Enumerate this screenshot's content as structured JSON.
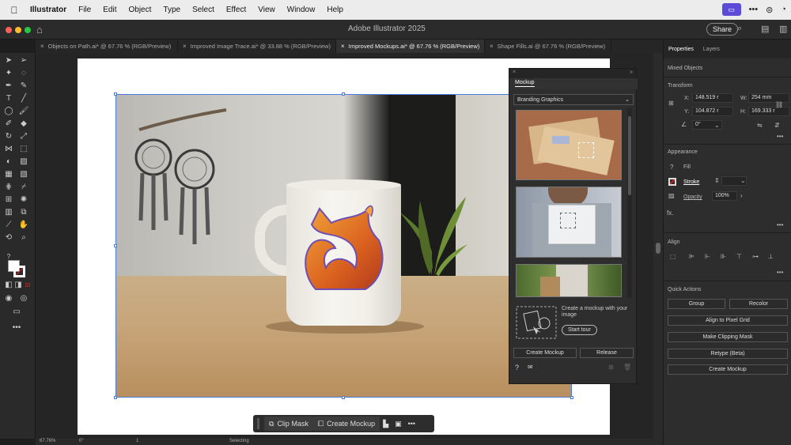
{
  "menubar": {
    "app_name": "Illustrator",
    "items": [
      "File",
      "Edit",
      "Object",
      "Type",
      "Select",
      "Effect",
      "View",
      "Window",
      "Help"
    ]
  },
  "titlebar": {
    "title": "Adobe Illustrator 2025",
    "share_label": "Share"
  },
  "tabs": [
    {
      "label": "Objects on Path.ai* @ 67.76 % (RGB/Preview)",
      "active": false
    },
    {
      "label": "Improved Image Trace.ai* @ 33.88 % (RGB/Preview)",
      "active": false
    },
    {
      "label": "Improved Mockups.ai* @ 67.76 % (RGB/Preview)",
      "active": true
    },
    {
      "label": "Shape Fills.ai @ 67.76 % (RGB/Preview)",
      "active": false
    }
  ],
  "context_bar": {
    "clip_mask": "Clip Mask",
    "create_mockup": "Create Mockup"
  },
  "mockup_panel": {
    "tab": "Mockup",
    "category": "Branding Graphics",
    "tour_text": "Create a mockup with your image",
    "start_tour": "Start tour",
    "create_mockup": "Create Mockup",
    "release": "Release"
  },
  "properties": {
    "tabs": [
      "Properties",
      "Layers"
    ],
    "selection": "Mixed Objects",
    "transform": {
      "label": "Transform",
      "x": "148.519 r",
      "y": "104.872 r",
      "w": "254 mm",
      "h": "169.333 r",
      "angle": "0°"
    },
    "appearance": {
      "label": "Appearance",
      "fill": "Fill",
      "stroke": "Stroke",
      "opacity_label": "Opacity",
      "opacity": "100%"
    },
    "align_label": "Align",
    "quick_actions": {
      "label": "Quick Actions",
      "group": "Group",
      "recolor": "Recolor",
      "align_pixel": "Align to Pixel Grid",
      "clipping_mask": "Make Clipping Mask",
      "retype": "Retype (Beta)",
      "create_mockup": "Create Mockup"
    }
  },
  "status": {
    "zoom": "67.76%",
    "angle": "0°",
    "artboard": "1",
    "mode": "Selecting"
  },
  "colors": {
    "accent": "#4a7bd8",
    "menubar_badge": "#5b4bd8"
  }
}
